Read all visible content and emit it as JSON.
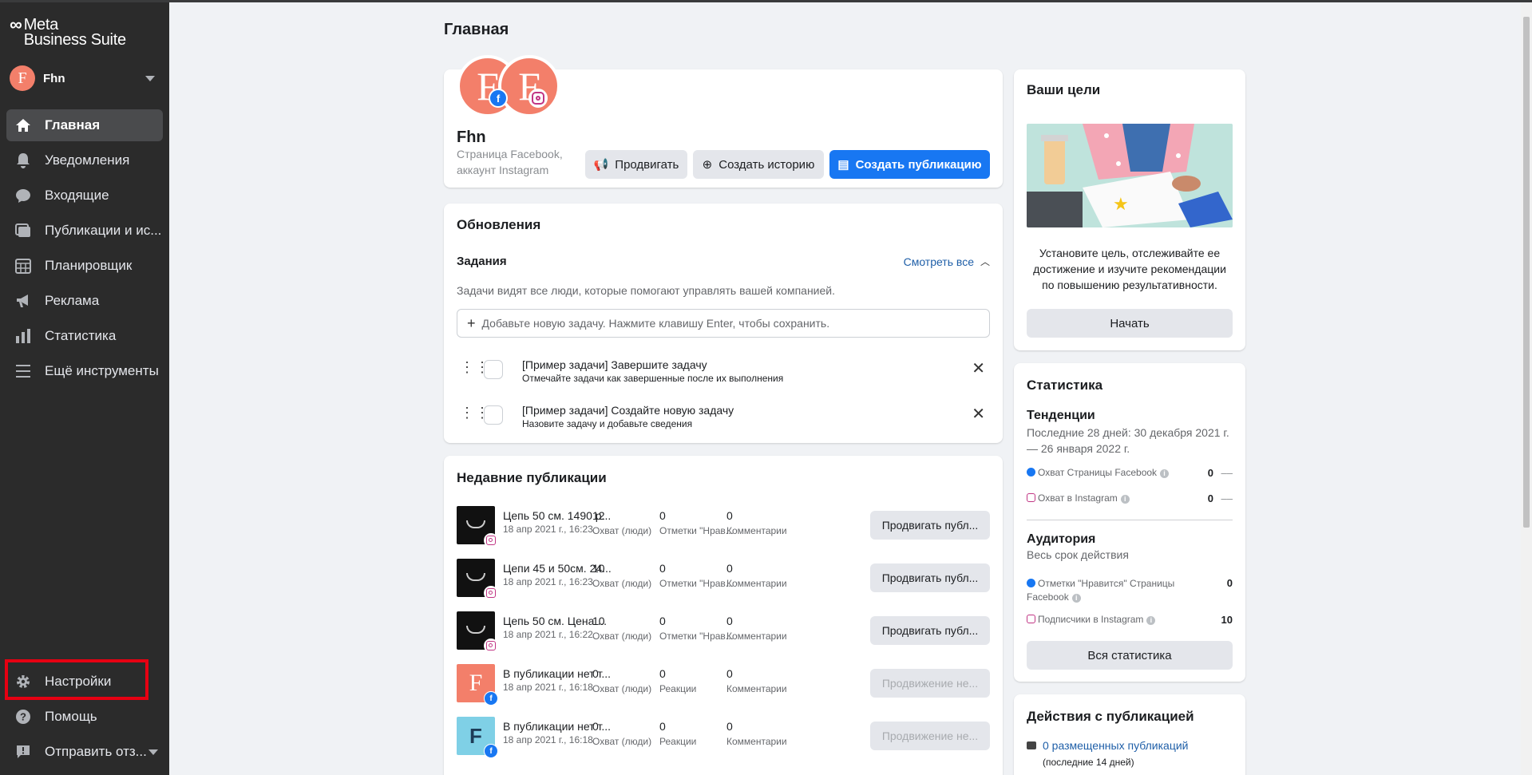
{
  "app": {
    "logo_top": "Meta",
    "logo_bottom": "Business Suite"
  },
  "account": {
    "initial": "F",
    "name": "Fhn"
  },
  "sidebar": {
    "items": [
      {
        "label": "Главная",
        "icon": "home-icon"
      },
      {
        "label": "Уведомления",
        "icon": "bell-icon"
      },
      {
        "label": "Входящие",
        "icon": "chat-bubble-icon"
      },
      {
        "label": "Публикации и ис...",
        "icon": "posts-icon"
      },
      {
        "label": "Планировщик",
        "icon": "calendar-icon"
      },
      {
        "label": "Реклама",
        "icon": "megaphone-icon"
      },
      {
        "label": "Статистика",
        "icon": "bar-chart-icon"
      },
      {
        "label": "Ещё инструменты",
        "icon": "menu-icon"
      }
    ],
    "bottom": [
      {
        "label": "Настройки",
        "icon": "gear-icon"
      },
      {
        "label": "Помощь",
        "icon": "help-icon"
      },
      {
        "label": "Отправить отз...",
        "icon": "feedback-icon"
      }
    ]
  },
  "page": {
    "title": "Главная"
  },
  "profile": {
    "name": "Fhn",
    "type_line1": "Страница Facebook,",
    "type_line2": "аккаунт Instagram",
    "btn_promote": "Продвигать",
    "btn_story": "Создать историю",
    "btn_post": "Создать публикацию"
  },
  "updates": {
    "title": "Обновления",
    "tasks_title": "Задания",
    "see_all": "Смотреть все",
    "desc": "Задачи видят все люди, которые помогают управлять вашей компанией.",
    "input_placeholder": "Добавьте новую задачу. Нажмите клавишу Enter, чтобы сохранить.",
    "tasks": [
      {
        "title": "[Пример задачи] Завершите задачу",
        "sub": "Отмечайте задачи как завершенные после их выполнения"
      },
      {
        "title": "[Пример задачи] Создайте новую задачу",
        "sub": "Назовите задачу и добавьте сведения"
      }
    ]
  },
  "recent": {
    "title": "Недавние публикации",
    "posts": [
      {
        "title": "Цепь 50 см. 1490 р...",
        "date": "18 апр 2021 г., 16:23",
        "platform": "instagram",
        "thumb": "chain",
        "c1v": "12",
        "c1l": "Охват (люди)",
        "c2v": "0",
        "c2l": "Отметки \"Нрав...",
        "c3v": "0",
        "c3l": "Комментарии",
        "btn": "Продвигать публ...",
        "disabled": false
      },
      {
        "title": "Цепи 45 и 50см. 24...",
        "date": "18 апр 2021 г., 16:23",
        "platform": "instagram",
        "thumb": "chain",
        "c1v": "10",
        "c1l": "Охват (люди)",
        "c2v": "0",
        "c2l": "Отметки \"Нрав...",
        "c3v": "0",
        "c3l": "Комментарии",
        "btn": "Продвигать публ...",
        "disabled": false
      },
      {
        "title": "Цепь 50 см. Цена ...",
        "date": "18 апр 2021 г., 16:22",
        "platform": "instagram",
        "thumb": "chain",
        "c1v": "10",
        "c1l": "Охват (люди)",
        "c2v": "0",
        "c2l": "Отметки \"Нрав...",
        "c3v": "0",
        "c3l": "Комментарии",
        "btn": "Продвигать публ...",
        "disabled": false
      },
      {
        "title": "В публикации нет т...",
        "date": "18 апр 2021 г., 16:18",
        "platform": "facebook",
        "thumb": "F-coral",
        "c1v": "0",
        "c1l": "Охват (люди)",
        "c2v": "0",
        "c2l": "Реакции",
        "c3v": "0",
        "c3l": "Комментарии",
        "btn": "Продвижение не...",
        "disabled": true
      },
      {
        "title": "В публикации нет т...",
        "date": "18 апр 2021 г., 16:18",
        "platform": "facebook",
        "thumb": "F-blue",
        "c1v": "0",
        "c1l": "Охват (люди)",
        "c2v": "0",
        "c2l": "Реакции",
        "c3v": "0",
        "c3l": "Комментарии",
        "btn": "Продвижение не...",
        "disabled": true
      }
    ]
  },
  "goals": {
    "title": "Ваши цели",
    "desc": "Установите цель, отслеживайте ее достижение и изучите рекомендации по повышению результативности.",
    "btn": "Начать"
  },
  "stats": {
    "title": "Статистика",
    "trends_title": "Тенденции",
    "trends_range": "Последние 28 дней: 30 декабря 2021 г. — 26 января 2022 г.",
    "fb_reach_label": "Охват Страницы Facebook",
    "fb_reach_value": "0",
    "ig_reach_label": "Охват в Instagram",
    "ig_reach_value": "0",
    "dash": "––",
    "audience_title": "Аудитория",
    "audience_range": "Весь срок действия",
    "fb_likes_label": "Отметки \"Нравится\" Страницы Facebook",
    "fb_likes_value": "0",
    "ig_followers_label": "Подписчики в Instagram",
    "ig_followers_value": "10",
    "btn_all": "Вся статистика"
  },
  "actions": {
    "title": "Действия с публикацией",
    "link": "0 размещенных публикаций",
    "sub": "(последние 14 дней)"
  },
  "colors": {
    "sidebar": "#2b2b2b",
    "primary": "#1877f2",
    "coral": "#f37f6a",
    "highlight": "#e60012"
  }
}
